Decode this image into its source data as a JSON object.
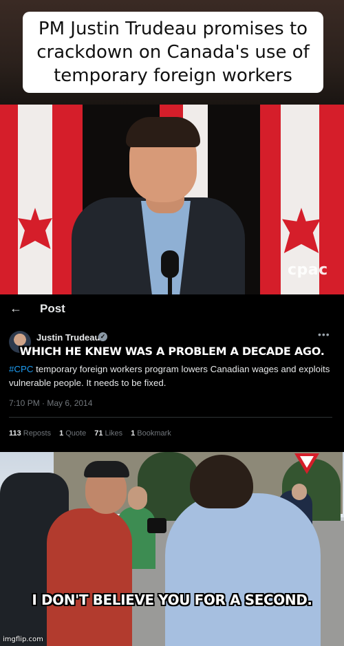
{
  "headline": {
    "text": "PM Justin Trudeau promises to crackdown on Canada's use of temporary foreign workers"
  },
  "video": {
    "broadcaster_logo": "cpac"
  },
  "tweet": {
    "header_title": "Post",
    "back_icon": "arrow-left-icon",
    "author_name": "Justin Trudeau",
    "verified_icon": "verified-badge-icon",
    "more_icon": "more-horizontal-icon",
    "body_hashtag": "#CPC",
    "body_text": " temporary foreign workers program lowers Canadian wages and exploits vulnerable people. It needs to be fixed.",
    "timestamp": "7:10 PM · May 6, 2014",
    "stats": [
      {
        "count": "113",
        "label": "Reposts"
      },
      {
        "count": "1",
        "label": "Quote"
      },
      {
        "count": "71",
        "label": "Likes"
      },
      {
        "count": "1",
        "label": "Bookmark"
      }
    ]
  },
  "captions": {
    "top": "WHICH HE KNEW WAS A PROBLEM A DECADE AGO.",
    "bottom": "I DON'T BELIEVE YOU FOR A SECOND."
  },
  "watermark": "imgflip.com",
  "colors": {
    "flag_red": "#d51e2a",
    "hashtag_blue": "#1d9bf0",
    "tweet_bg": "#000000"
  }
}
